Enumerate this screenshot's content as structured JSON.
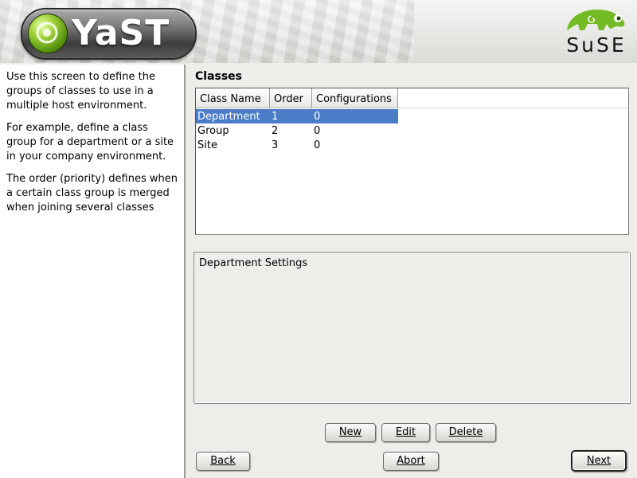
{
  "header": {
    "product_name": "YaST",
    "vendor_name": "SuSE"
  },
  "help": {
    "paragraphs": [
      "Use this screen to define the groups of classes to use in a multiple host environment.",
      "For example, define a class group for a department or a site in your company environment.",
      "The order (priority) defines when a certain class group is merged when joining several classes"
    ]
  },
  "main": {
    "title": "Classes",
    "table": {
      "columns": [
        "Class Name",
        "Order",
        "Configurations"
      ],
      "rows": [
        {
          "name": "Department",
          "order": "1",
          "configurations": "0",
          "selected": true
        },
        {
          "name": "Group",
          "order": "2",
          "configurations": "0",
          "selected": false
        },
        {
          "name": "Site",
          "order": "3",
          "configurations": "0",
          "selected": false
        }
      ]
    },
    "settings_title": "Department Settings"
  },
  "buttons": {
    "new": "New",
    "edit": "Edit",
    "delete": "Delete",
    "back": "Back",
    "abort": "Abort",
    "next": "Next"
  },
  "colors": {
    "selection": "#4a7cc8",
    "background": "#eeede9",
    "logo_green": "#73ba25"
  },
  "icons": [
    "yast-logo-icon",
    "suse-chameleon-icon"
  ]
}
